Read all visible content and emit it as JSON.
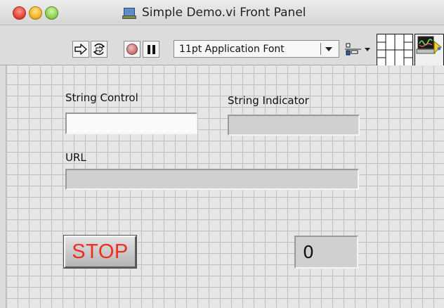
{
  "window": {
    "title": "Simple Demo.vi Front Panel"
  },
  "toolbar": {
    "run_icon": "run-arrow-icon",
    "run_continuously_icon": "run-continuously-icon",
    "abort_icon": "abort-icon",
    "pause_icon": "pause-icon",
    "font_label": "11pt Application Font",
    "align_icon": "align-objects-icon"
  },
  "panel": {
    "string_control": {
      "label": "String Control",
      "value": ""
    },
    "string_indicator": {
      "label": "String Indicator",
      "value": ""
    },
    "url": {
      "label": "URL",
      "value": ""
    },
    "stop_button": {
      "label": "STOP"
    },
    "numeric_indicator": {
      "value": "0"
    }
  },
  "colors": {
    "stop_text": "#f02d1e",
    "grid_line": "#bfbfbf",
    "panel_bg": "#e6e6e6"
  }
}
